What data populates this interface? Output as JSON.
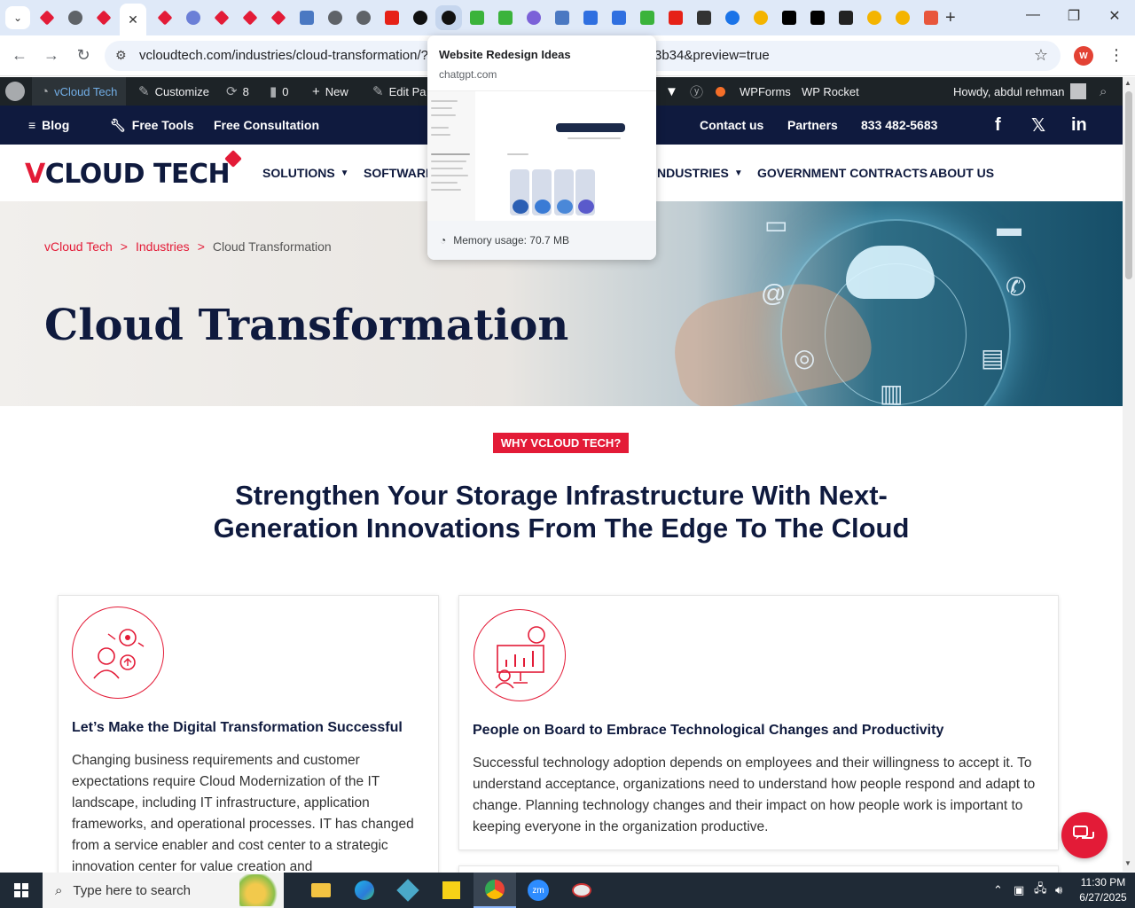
{
  "browser": {
    "url": "vcloudtech.com/industries/cloud-transformation/?pr",
    "url_tail": "3b34&preview=true",
    "profile_initial": "W",
    "active_tab_close": "✕",
    "new_tab": "+"
  },
  "hover_card": {
    "title": "Website Redesign Ideas",
    "domain": "chatgpt.com",
    "memory": "Memory usage: 70.7 MB"
  },
  "wp_admin_bar": {
    "site_name": "vCloud Tech",
    "customize": "Customize",
    "updates": "8",
    "comments": "0",
    "new": "New",
    "edit": "Edit Pa",
    "wpforms": "WPForms",
    "wprocket": "WP Rocket",
    "howdy": "Howdy, abdul rehman"
  },
  "topbar": {
    "blog": "Blog",
    "free_tools": "Free Tools",
    "free_consultation": "Free Consultation",
    "contact": "Contact us",
    "partners": "Partners",
    "phone": "833 482-5683",
    "facebook": "f",
    "x": "𝕏",
    "linkedin": "in"
  },
  "logo": {
    "v": "V",
    "rest": "CLOUD TECH"
  },
  "nav": {
    "solutions": "SOLUTIONS",
    "software": "SOFTWARE",
    "industries": "NDUSTRIES",
    "government": "GOVERNMENT CONTRACTS",
    "about": "ABOUT US"
  },
  "breadcrumb": {
    "home": "vCloud Tech",
    "sep": ">",
    "parent": "Industries",
    "current": "Cloud Transformation"
  },
  "hero": {
    "title": "Cloud Transformation"
  },
  "section": {
    "badge": "WHY VCLOUD TECH?",
    "title": "Strengthen Your Storage Infrastructure With Next-Generation Innovations From The Edge To The Cloud"
  },
  "cards": [
    {
      "title": "Let’s Make the Digital Transformation Successful",
      "body": "Changing business requirements and customer expectations require Cloud Modernization of the IT landscape, including IT infrastructure, application frameworks, and operational processes. IT has changed from a service enabler and cost center to a strategic innovation center for value creation and"
    },
    {
      "title": "People on Board to Embrace Technological Changes and Productivity",
      "body": "Successful technology adoption depends on employees and their willingness to accept it. To understand acceptance, organizations need to understand how people respond and adapt to change. Planning technology changes and their impact on how people work is important to keeping everyone in the organization productive."
    }
  ],
  "taskbar": {
    "search_placeholder": "Type here to search",
    "time": "11:30 PM",
    "date": "6/27/2025"
  },
  "colors": {
    "brand_red": "#e31b37",
    "navy": "#0f1a3e",
    "wp_bar": "#1d2327"
  }
}
